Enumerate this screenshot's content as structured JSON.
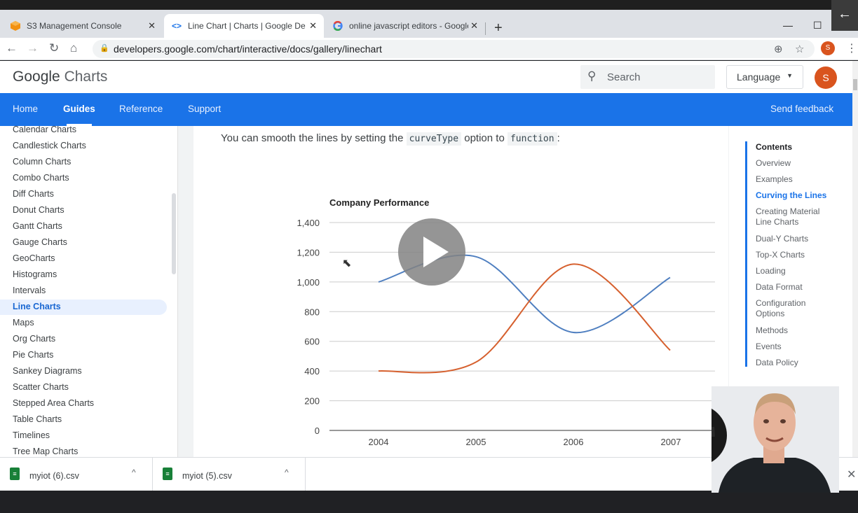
{
  "tabs": [
    {
      "title": "S3 Management Console",
      "favicon": "aws-cube-icon"
    },
    {
      "title": "Line Chart | Charts | Google De",
      "favicon": "code-brackets-icon"
    },
    {
      "title": "online javascript editors - Google",
      "favicon": "google-g-icon"
    }
  ],
  "address": {
    "url": "developers.google.com/chart/interactive/docs/gallery/linechart"
  },
  "header": {
    "logo_google": "Google",
    "logo_charts": "Charts",
    "search_placeholder": "Search",
    "language_label": "Language",
    "avatar_initial": "S"
  },
  "nav": {
    "items": [
      "Home",
      "Guides",
      "Reference",
      "Support"
    ],
    "active": "Guides",
    "feedback": "Send feedback"
  },
  "sidebar": {
    "items": [
      "Calendar Charts",
      "Candlestick Charts",
      "Column Charts",
      "Combo Charts",
      "Diff Charts",
      "Donut Charts",
      "Gantt Charts",
      "Gauge Charts",
      "GeoCharts",
      "Histograms",
      "Intervals",
      "Line Charts",
      "Maps",
      "Org Charts",
      "Pie Charts",
      "Sankey Diagrams",
      "Scatter Charts",
      "Stepped Area Charts",
      "Table Charts",
      "Timelines",
      "Tree Map Charts"
    ],
    "active": "Line Charts"
  },
  "article": {
    "para_before": "You can smooth the lines by setting the",
    "code1": "curveType",
    "para_mid": "option to",
    "code2": "function",
    "para_after": ":"
  },
  "toc": {
    "items": [
      "Contents",
      "Overview",
      "Examples",
      "Curving the Lines",
      "Creating Material Line Charts",
      "Dual-Y Charts",
      "Top-X Charts",
      "Loading",
      "Data Format",
      "Configuration Options",
      "Methods",
      "Events",
      "Data Policy"
    ],
    "active": "Curving the Lines"
  },
  "downloads": [
    {
      "name": "myiot (6).csv"
    },
    {
      "name": "myiot (5).csv"
    }
  ],
  "colors": {
    "blue_series": "#4f7fc0",
    "orange_series": "#d6602e",
    "nav_blue": "#1a73e8"
  },
  "chart_data": {
    "type": "line",
    "title": "Company Performance",
    "categories": [
      "2004",
      "2005",
      "2006",
      "2007"
    ],
    "series": [
      {
        "values": [
          1000,
          1170,
          660,
          1030
        ],
        "color": "#4f7fc0"
      },
      {
        "values": [
          400,
          460,
          1120,
          540
        ],
        "color": "#d6602e"
      }
    ],
    "ylim": [
      0,
      1400
    ],
    "yticks": [
      0,
      200,
      400,
      600,
      800,
      1000,
      1200,
      1400
    ],
    "ytick_labels": [
      "0",
      "200",
      "400",
      "600",
      "800",
      "1,000",
      "1,200",
      "1,400"
    ],
    "xlabel": "",
    "ylabel": "",
    "curve": "smooth",
    "grid": true
  }
}
